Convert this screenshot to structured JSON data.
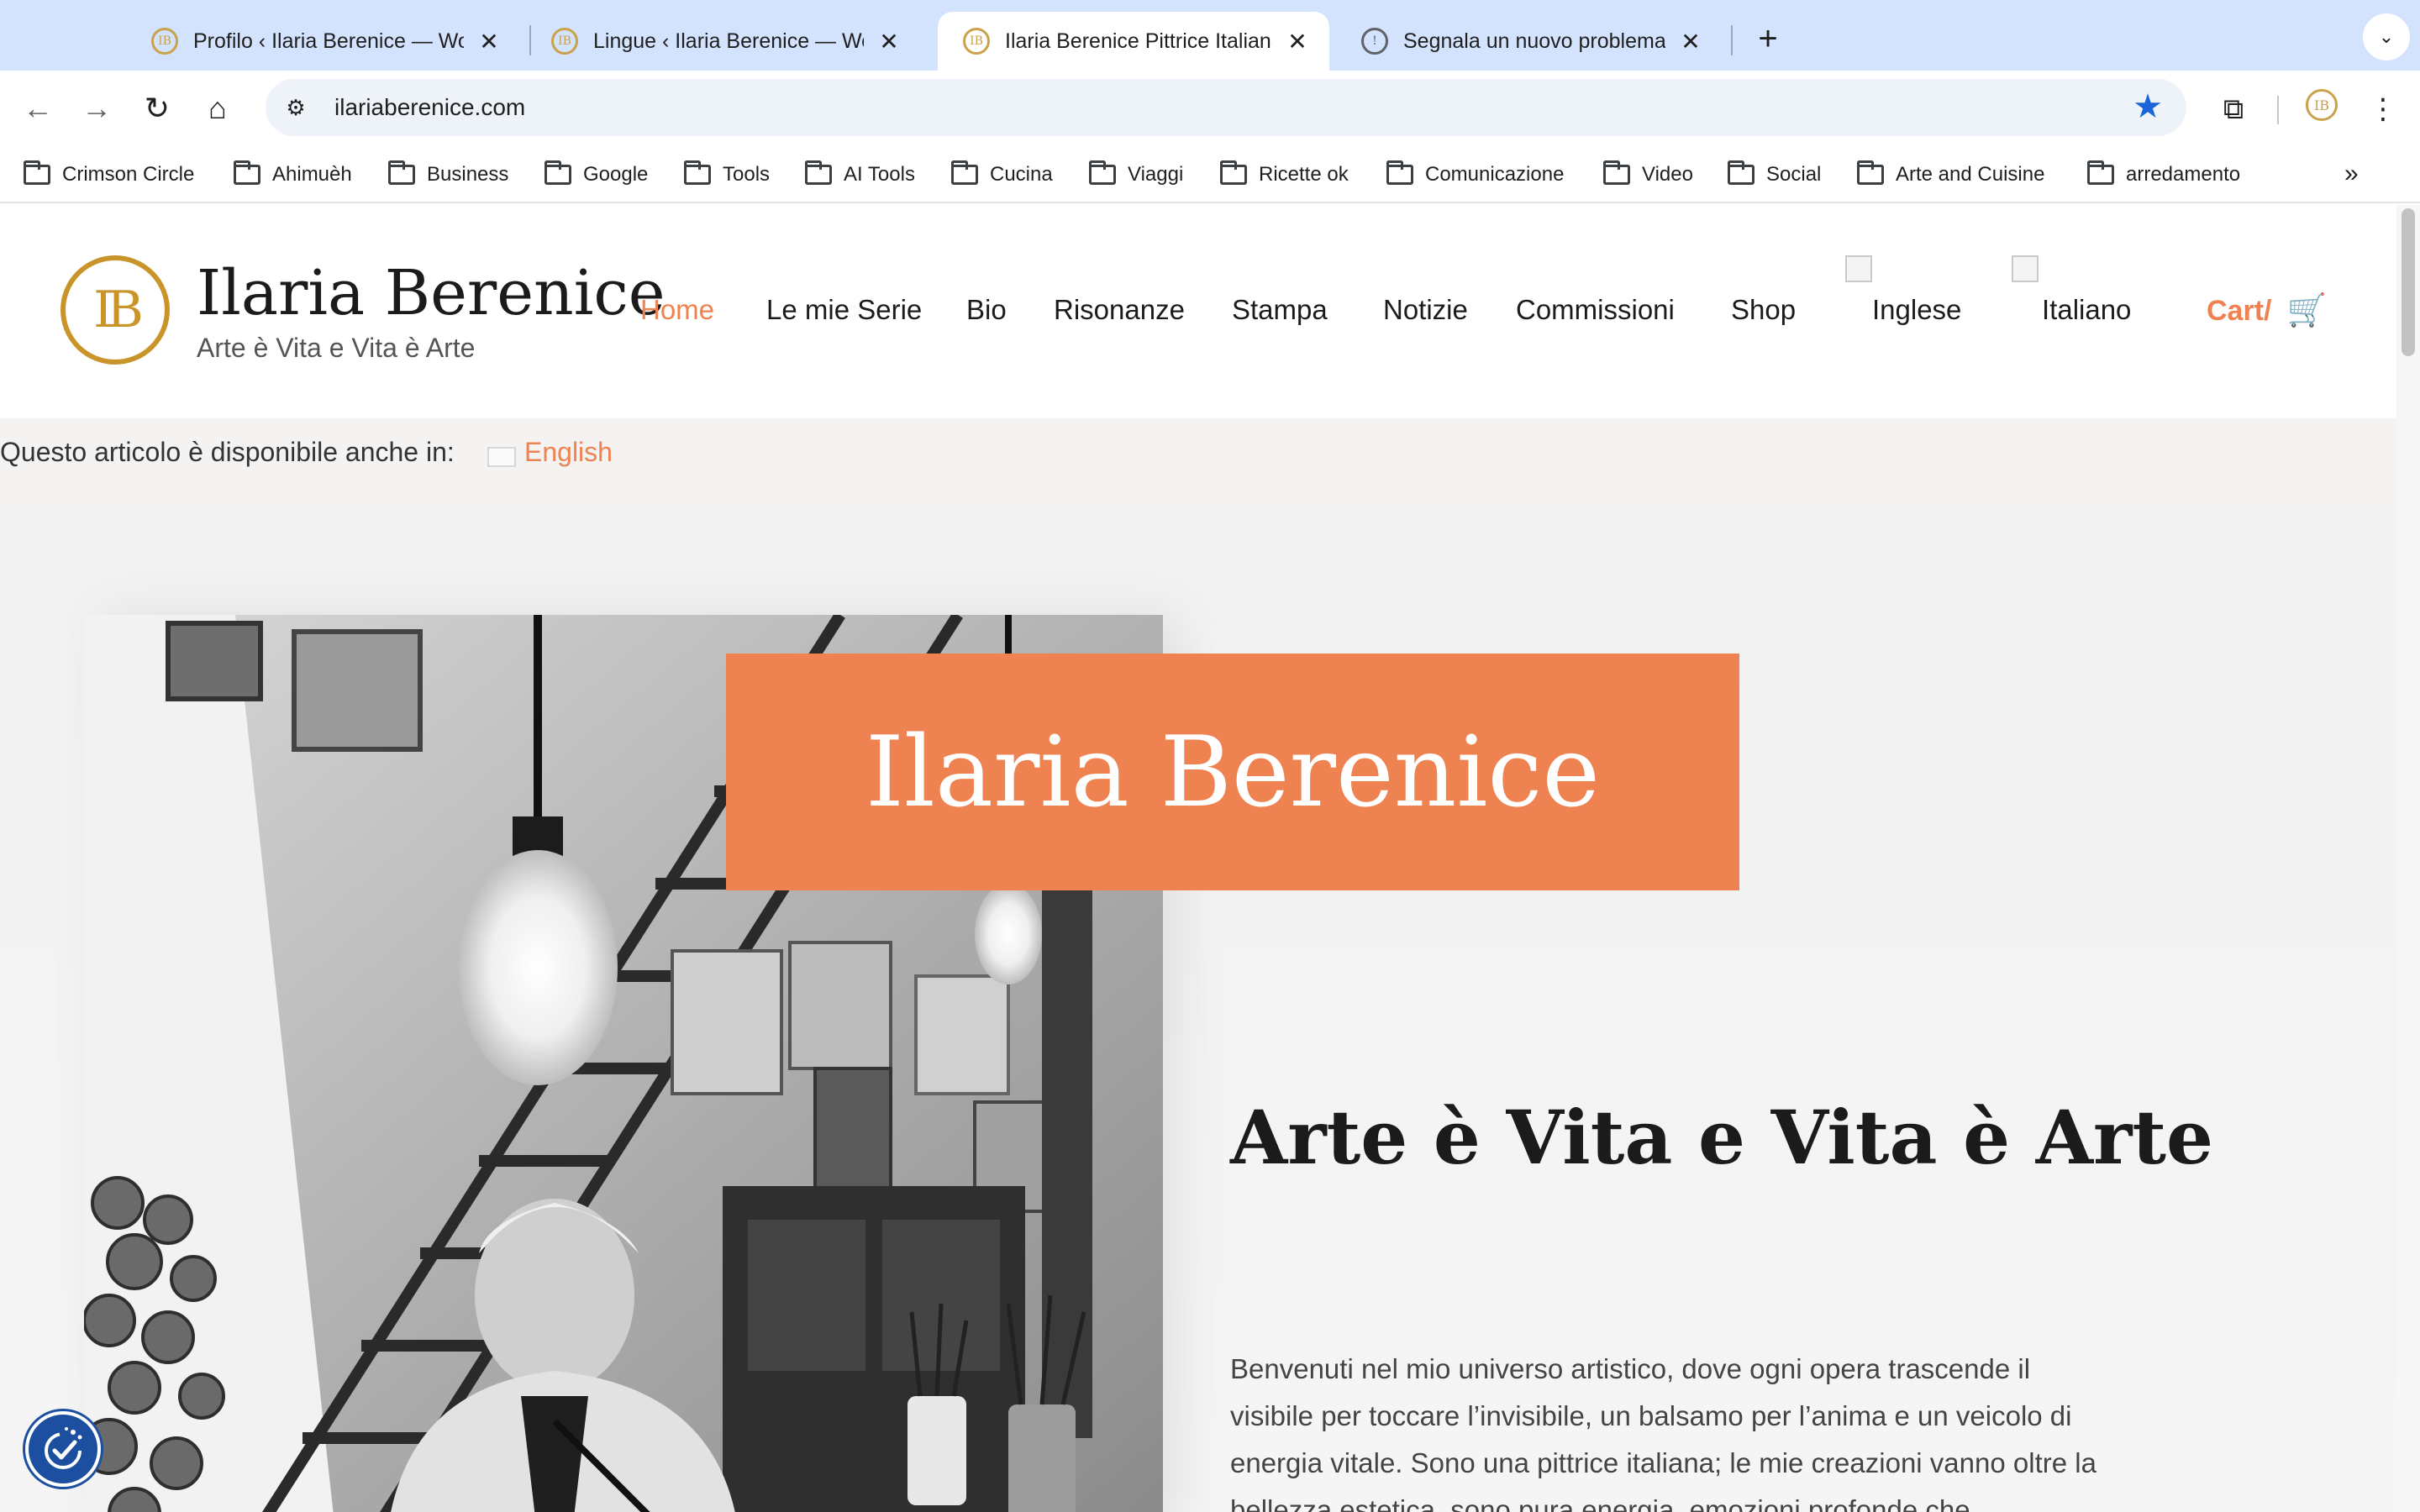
{
  "browser": {
    "tabs": [
      {
        "title": "Profilo ‹ Ilaria Berenice — Wor",
        "favicon": "ib-logo-icon",
        "active": false
      },
      {
        "title": "Lingue ‹ Ilaria Berenice — Wo",
        "favicon": "ib-logo-icon",
        "active": false
      },
      {
        "title": "Ilaria Berenice Pittrice Italiana",
        "favicon": "ib-logo-icon",
        "active": true
      },
      {
        "title": "Segnala un nuovo problema -",
        "favicon": "bug-report-icon",
        "active": false
      }
    ],
    "url": "ilariaberenice.com",
    "bookmarks": [
      "Crimson Circle",
      "Ahimuèh",
      "Business",
      "Google",
      "Tools",
      "AI Tools",
      "Cucina",
      "Viaggi",
      "Ricette ok",
      "Comunicazione",
      "Video",
      "Social",
      "Arte and Cuisine",
      "arredamento"
    ]
  },
  "header": {
    "logo_text": "IB",
    "site_title": "Ilaria Berenice",
    "tagline": "Arte è Vita e Vita è Arte",
    "menu": [
      "Home",
      "Le mie Serie",
      "Bio",
      "Risonanze",
      "Stampa",
      "Notizie",
      "Commissioni",
      "Shop",
      "Inglese",
      "Italiano"
    ],
    "current_menu": "Home",
    "cart_label": "Cart/"
  },
  "lang_notice": {
    "text": "Questo articolo è disponibile anche in:",
    "link": "English"
  },
  "hero": {
    "name": "Ilaria Berenice",
    "motto": "Arte è Vita e Vita è Arte",
    "intro": "Benvenuti nel mio universo artistico, dove ogni opera trascende il visibile per toccare l’invisibile, un balsamo per l’anima e un veicolo di energia vitale. Sono una pittrice italiana; le mie creazioni vanno oltre la bellezza estetica, sono pura energia, emozioni profonde che"
  },
  "colors": {
    "accent": "#ef8251",
    "gold": "#c9952b",
    "tab_strip": "#d3e3fd",
    "a11y": "#1d4fa0"
  }
}
